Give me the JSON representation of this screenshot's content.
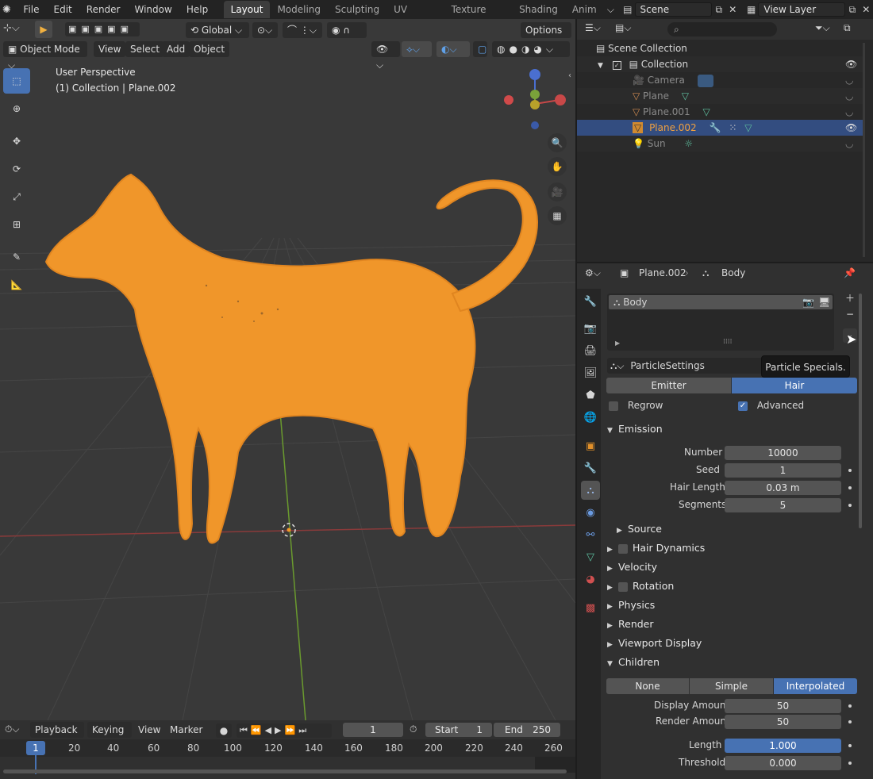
{
  "menu": [
    "File",
    "Edit",
    "Render",
    "Window",
    "Help"
  ],
  "workspaces": [
    "Layout",
    "Modeling",
    "Sculpting",
    "UV Editing",
    "Texture Paint",
    "Shading",
    "Anim"
  ],
  "scene_name": "Scene",
  "view_layer": "View Layer",
  "viewport": {
    "transform_orientation": "Global",
    "options_label": "Options",
    "mode": "Object Mode",
    "menus": [
      "View",
      "Select",
      "Add",
      "Object"
    ],
    "perspective": "User Perspective",
    "collection_info": "(1) Collection | Plane.002"
  },
  "outliner": {
    "root": "Scene Collection",
    "collection": "Collection",
    "items": [
      "Camera",
      "Plane",
      "Plane.001",
      "Plane.002",
      "Sun"
    ]
  },
  "properties": {
    "breadcrumb_object": "Plane.002",
    "breadcrumb_system": "Body",
    "system_name": "Body",
    "settings_name": "ParticleSettings",
    "tooltip": "Particle Specials.",
    "type_options": [
      "Emitter",
      "Hair"
    ],
    "regrow_label": "Regrow",
    "advanced_label": "Advanced",
    "emission": {
      "title": "Emission",
      "number_label": "Number",
      "number": "10000",
      "seed_label": "Seed",
      "seed": "1",
      "hair_length_label": "Hair Length",
      "hair_length": "0.03 m",
      "segments_label": "Segments",
      "segments": "5",
      "source_label": "Source"
    },
    "sections": [
      "Hair Dynamics",
      "Velocity",
      "Rotation",
      "Physics",
      "Render",
      "Viewport Display",
      "Children"
    ],
    "children_options": [
      "None",
      "Simple",
      "Interpolated"
    ],
    "children": {
      "display_amount_label": "Display Amount",
      "display_amount": "50",
      "render_amount_label": "Render Amount",
      "render_amount": "50",
      "length_label": "Length",
      "length": "1.000",
      "threshold_label": "Threshold",
      "threshold": "0.000"
    }
  },
  "timeline": {
    "menus": [
      "Playback",
      "Keying",
      "View",
      "Marker"
    ],
    "current_frame": "1",
    "start_label": "Start",
    "start": "1",
    "end_label": "End",
    "end": "250",
    "ticks": [
      "1",
      "20",
      "40",
      "60",
      "80",
      "100",
      "120",
      "140",
      "160",
      "180",
      "200",
      "220",
      "240",
      "260"
    ]
  }
}
